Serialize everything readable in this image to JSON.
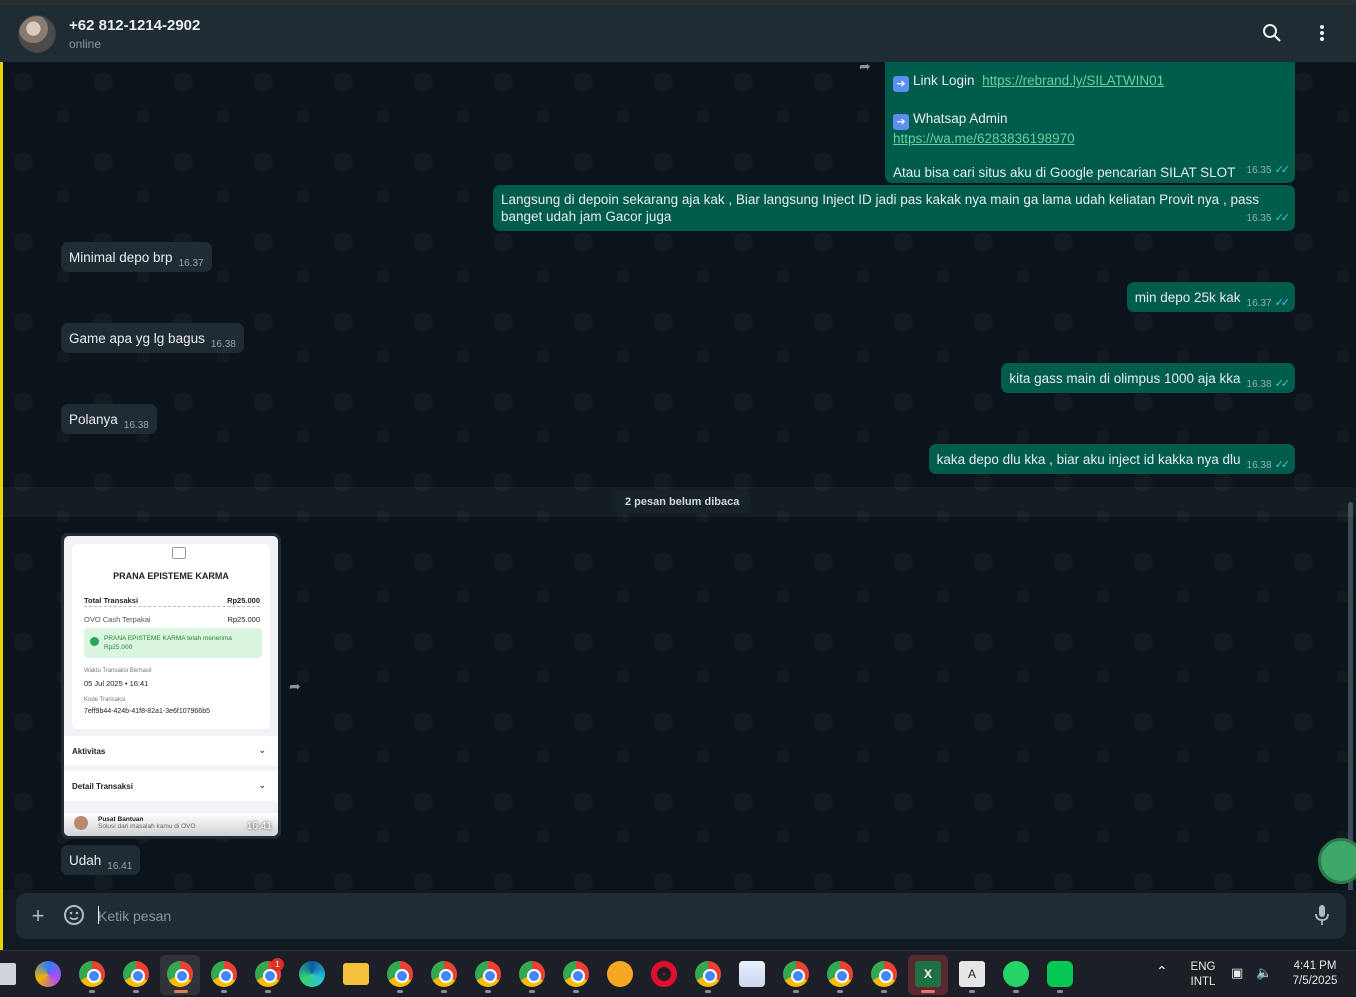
{
  "header": {
    "contact_name": "+62 812-1214-2902",
    "status": "online"
  },
  "messages": {
    "m1": {
      "line1_label": "Link Login",
      "line1_link": "https://rebrand.ly/SILATWIN01",
      "line2_label": "Whatsap Admin",
      "line2_link": "https://wa.me/6283836198970",
      "line3": "Atau bisa cari situs aku di Google pencarian SILAT SLOT",
      "time": "16.35"
    },
    "m2": {
      "text": "Langsung di depoin sekarang aja kak , Biar langsung Inject ID jadi pas kakak nya main ga lama udah keliatan Provit nya , pass banget udah jam Gacor juga",
      "time": "16.35"
    },
    "m3": {
      "text": "Minimal depo brp",
      "time": "16.37"
    },
    "m4": {
      "text": "min depo 25k kak",
      "time": "16.37"
    },
    "m5": {
      "text": "Game apa yg lg bagus",
      "time": "16.38"
    },
    "m6": {
      "text": "kita gass main di olimpus 1000 aja kka",
      "time": "16.38"
    },
    "m7": {
      "text": "Polanya",
      "time": "16.38"
    },
    "m8": {
      "text": "kaka depo dlu kka , biar aku inject id kakka nya dlu",
      "time": "16.38"
    },
    "m10": {
      "text": "Udah",
      "time": "16.41"
    }
  },
  "unread_divider": "2 pesan belum dibaca",
  "receipt": {
    "merchant": "PRANA EPISTEME KARMA",
    "total_label": "Total Transaksi",
    "total_value": "Rp25.000",
    "method_label": "OVO Cash Terpakai",
    "method_value": "Rp25.000",
    "success_text": "PRANA EPISTEME KARMA telah menerima",
    "success_amount": "Rp25.000",
    "time_label": "Waktu Transaksi Berhasil",
    "time_value": "05 Jul 2025 • 16:41",
    "code_label": "Kode Transaksi",
    "code_value": "7eff9b44-424b-41f8-82a1-3e6f107966b5",
    "section1": "Aktivitas",
    "section2": "Detail Transaksi",
    "help_title": "Pusat Bantuan",
    "help_sub": "Solusi dari masalah kamu di OVO",
    "time": "16.41"
  },
  "composer": {
    "placeholder": "Ketik pesan"
  },
  "taskbar": {
    "lang_top": "ENG",
    "lang_bottom": "INTL",
    "time": "4:41 PM",
    "date": "7/5/2025",
    "badge_count": "1",
    "excel_label": "X",
    "font_app_label": "A"
  },
  "icons": {
    "search": "search-icon",
    "menu": "more-vertical-icon",
    "plus": "plus-icon",
    "sticker": "sticker-icon",
    "mic": "mic-icon",
    "ticks": "double-check-icon",
    "forward": "forward-icon"
  },
  "colors": {
    "outgoing_bubble": "#005c4b",
    "incoming_bubble": "#202c33",
    "chat_bg": "#0b141a",
    "read_ticks": "#53bdeb"
  }
}
